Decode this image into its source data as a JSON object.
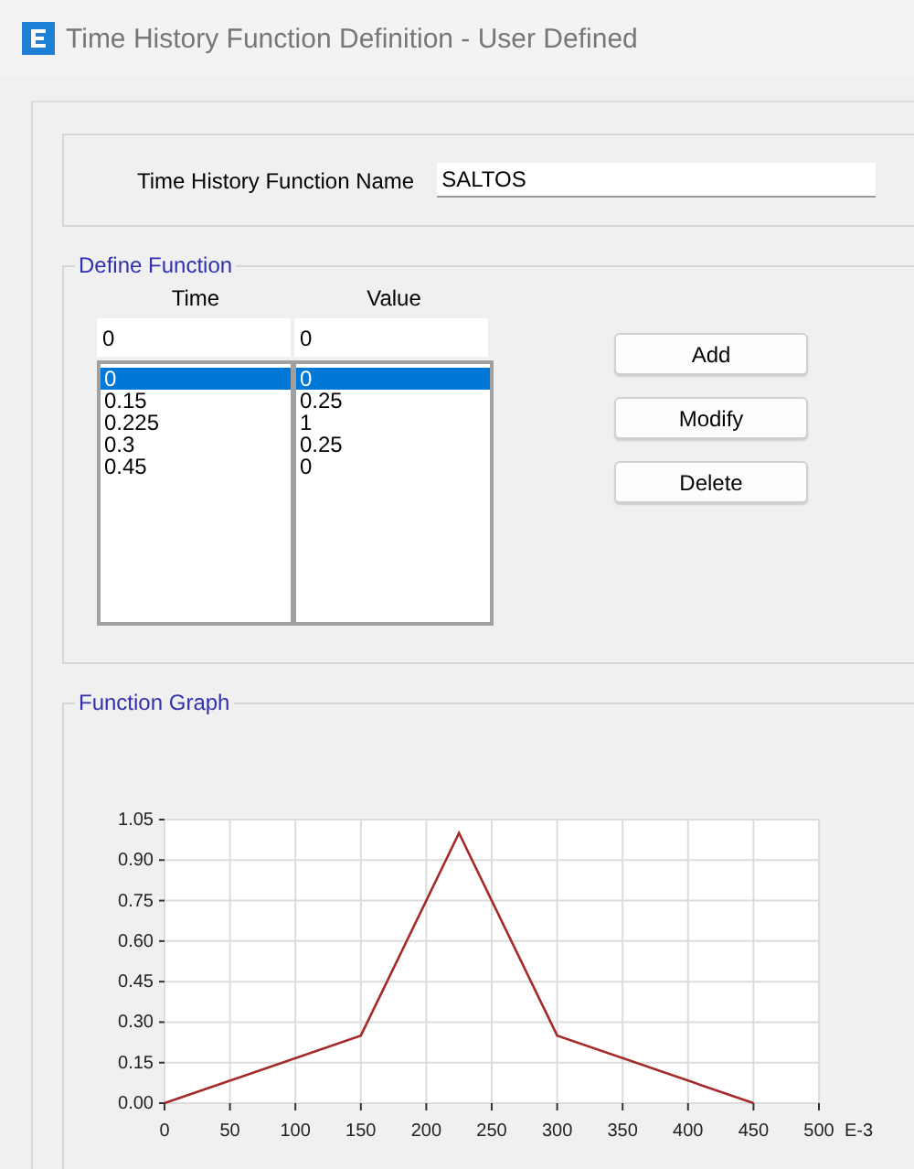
{
  "window": {
    "title": "Time History Function Definition  - User Defined"
  },
  "name_field": {
    "label": "Time History Function Name",
    "value": "SALTOS"
  },
  "define_function": {
    "title": "Define Function",
    "columns": [
      "Time",
      "Value"
    ],
    "inputs": [
      "0",
      "0"
    ],
    "rows": [
      {
        "time": "0",
        "value": "0",
        "selected": true
      },
      {
        "time": "0.15",
        "value": "0.25",
        "selected": false
      },
      {
        "time": "0.225",
        "value": "1",
        "selected": false
      },
      {
        "time": "0.3",
        "value": "0.25",
        "selected": false
      },
      {
        "time": "0.45",
        "value": "0",
        "selected": false
      }
    ],
    "buttons": [
      "Add",
      "Modify",
      "Delete"
    ]
  },
  "function_graph": {
    "title": "Function Graph",
    "chart_data": {
      "type": "line",
      "xlabel": "E-3",
      "x": [
        0,
        150,
        225,
        300,
        450
      ],
      "series": [
        {
          "color": "#a52a2a",
          "values": [
            0,
            0.25,
            1,
            0.25,
            0
          ]
        }
      ],
      "grid": true,
      "xlim": [
        0,
        500
      ],
      "ylim": [
        0,
        1.05
      ],
      "xticks": [
        0,
        50,
        100,
        150,
        200,
        250,
        300,
        350,
        400,
        450,
        500
      ],
      "yticks": [
        {
          "value": 0,
          "label": "0.00"
        },
        {
          "value": 0.15,
          "label": "0.15"
        },
        {
          "value": 0.3,
          "label": "0.30"
        },
        {
          "value": 0.45,
          "label": "0.45"
        },
        {
          "value": 0.6,
          "label": "0.60"
        },
        {
          "value": 0.75,
          "label": "0.75"
        },
        {
          "value": 0.9,
          "label": "0.90"
        },
        {
          "value": 1.05,
          "label": "1.05"
        }
      ]
    }
  }
}
